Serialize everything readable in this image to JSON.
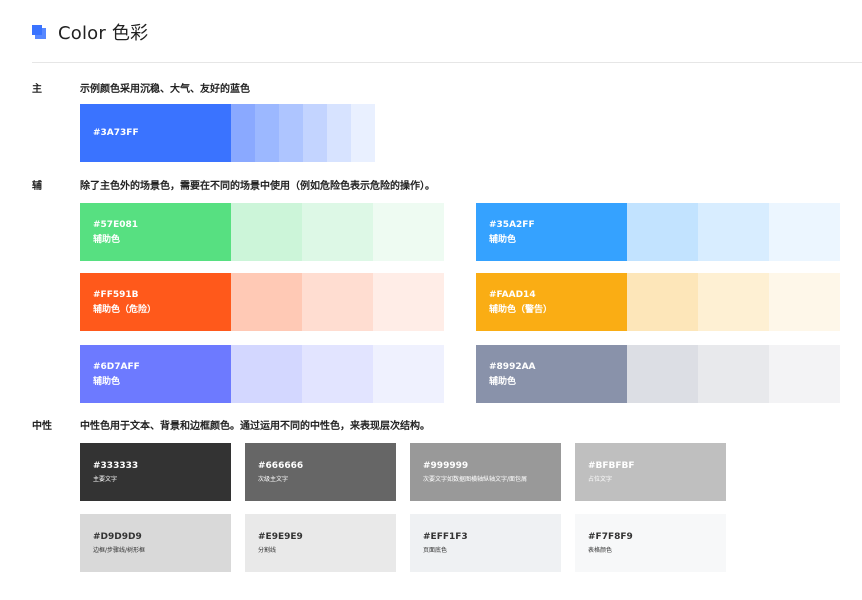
{
  "header": {
    "title": "Color 色彩"
  },
  "primary": {
    "label": "主",
    "description": "示例颜色采用沉稳、大气、友好的蓝色",
    "hex": "#3A73FF",
    "shades": [
      "#8AA9FF",
      "#9CB8FF",
      "#AEC5FF",
      "#C3D4FF",
      "#D7E3FF",
      "#E9F0FF"
    ]
  },
  "secondary": {
    "label": "辅",
    "description": "除了主色外的场景色，需要在不同的场景中使用（例如危险色表示危险的操作）。",
    "swatches": [
      {
        "hex": "#57E081",
        "name": "辅助色",
        "color": "#57E081",
        "tints": [
          "#CCF5D9",
          "#DDF8E6",
          "#EEFBF2"
        ]
      },
      {
        "hex": "#35A2FF",
        "name": "辅助色",
        "color": "#35A2FF",
        "tints": [
          "#C2E3FF",
          "#D8EDFF",
          "#ECF6FF"
        ]
      },
      {
        "hex": "#FF591B",
        "name": "辅助色（危险）",
        "color": "#FF591B",
        "tints": [
          "#FFC9B5",
          "#FFDDD1",
          "#FFEDE7"
        ]
      },
      {
        "hex": "#FAAD14",
        "name": "辅助色（警告）",
        "color": "#FAAD14",
        "tints": [
          "#FDE6B9",
          "#FEF0D3",
          "#FEF7E9"
        ]
      },
      {
        "hex": "#6D7AFF",
        "name": "辅助色",
        "color": "#6D7AFF",
        "tints": [
          "#D3D7FF",
          "#E2E4FF",
          "#EFF1FE"
        ]
      },
      {
        "hex": "#8992AA",
        "name": "辅助色",
        "color": "#8992AA",
        "tints": [
          "#DCDEE4",
          "#E8E9EC",
          "#F3F3F5"
        ]
      }
    ]
  },
  "neutral": {
    "label": "中性",
    "description": "中性色用于文本、背景和边框颜色。通过运用不同的中性色，来表现层次结构。",
    "swatches": [
      {
        "hex": "#333333",
        "name": "主要文字",
        "color": "#333333",
        "text": "#ffffff"
      },
      {
        "hex": "#666666",
        "name": "次级主文字",
        "color": "#666666",
        "text": "#ffffff"
      },
      {
        "hex": "#999999",
        "name": "次要文字如数据图横轴纵轴文字/面包屑",
        "color": "#999999",
        "text": "#ffffff"
      },
      {
        "hex": "#BFBFBF",
        "name": "占位文字",
        "color": "#BFBFBF",
        "text": "#ffffff"
      },
      {
        "hex": "#D9D9D9",
        "name": "边框/步骤线/树形框",
        "color": "#D9D9D9",
        "text": "#333333"
      },
      {
        "hex": "#E9E9E9",
        "name": "分割线",
        "color": "#E9E9E9",
        "text": "#333333"
      },
      {
        "hex": "#EFF1F3",
        "name": "页面底色",
        "color": "#EFF1F3",
        "text": "#333333"
      },
      {
        "hex": "#F7F8F9",
        "name": "表格颜色",
        "color": "#F7F8F9",
        "text": "#333333"
      }
    ]
  }
}
